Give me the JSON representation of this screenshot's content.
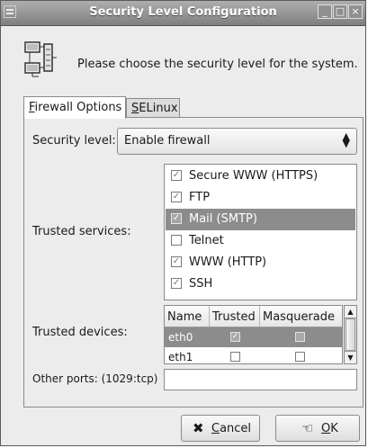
{
  "window": {
    "title": "Security Level Configuration",
    "controls": [
      "_",
      "□",
      "×"
    ]
  },
  "header": {
    "text": "Please choose the security level for the system."
  },
  "tabs": [
    {
      "label": "Firewall Options",
      "mnemonic": "F",
      "rest": "irewall Options",
      "active": true
    },
    {
      "label": "SELinux",
      "mnemonic": "S",
      "rest": "ELinux",
      "active": false
    }
  ],
  "firewall": {
    "security_level_label": "Security level:",
    "security_level_value": "Enable firewall",
    "trusted_services_label": "Trusted services:",
    "services": [
      {
        "name": "Secure WWW (HTTPS)",
        "checked": true,
        "selected": false
      },
      {
        "name": "FTP",
        "checked": true,
        "selected": false
      },
      {
        "name": "Mail (SMTP)",
        "checked": true,
        "selected": true
      },
      {
        "name": "Telnet",
        "checked": false,
        "selected": false
      },
      {
        "name": "WWW (HTTP)",
        "checked": true,
        "selected": false
      },
      {
        "name": "SSH",
        "checked": true,
        "selected": false
      }
    ],
    "trusted_devices_label": "Trusted devices:",
    "devices_columns": [
      "Name",
      "Trusted",
      "Masquerade"
    ],
    "devices": [
      {
        "name": "eth0",
        "trusted": true,
        "masquerade": false,
        "selected": true
      },
      {
        "name": "eth1",
        "trusted": false,
        "masquerade": false,
        "selected": false
      }
    ],
    "other_ports_label": "Other ports: (1029:tcp)",
    "other_ports_value": ""
  },
  "buttons": {
    "cancel": {
      "label": "Cancel",
      "mnemonic": "C",
      "rest": "ancel",
      "icon": "cancel-x-icon"
    },
    "ok": {
      "label": "OK",
      "mnemonic": "O",
      "rest": "K",
      "icon": "ok-hand-icon"
    }
  },
  "colors": {
    "titlebar": "#8f8f8f",
    "selection": "#8c8c8c",
    "window_bg": "#ececec"
  }
}
